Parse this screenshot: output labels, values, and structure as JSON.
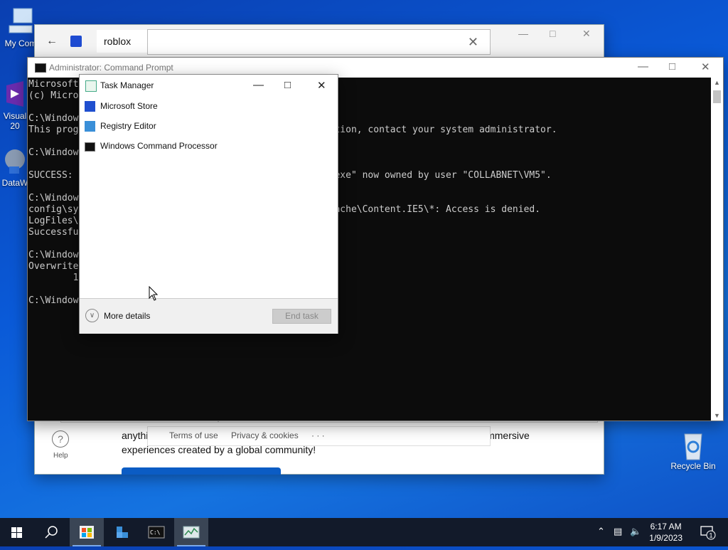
{
  "desktop": {
    "icons": [
      {
        "label": "My Com",
        "icon": "computer-icon"
      },
      {
        "label": "Visual",
        "sublabel": "20",
        "icon": "visual-studio-icon"
      },
      {
        "label": "DataW",
        "icon": "datawarehouse-icon"
      },
      {
        "label": "Recycle Bin",
        "icon": "recycle-bin-icon"
      }
    ]
  },
  "store": {
    "tab_label": "roblox",
    "search_value": "",
    "help_label": "Help",
    "description": "anythi                                                                                               immersive experiences created by a global community!",
    "description_line1_left": "anythi",
    "description_line1_right": "immersive",
    "description_line2": "experiences created by a global community!",
    "footer": {
      "terms": "Terms of use",
      "privacy": "Privacy & cookies",
      "more": "· · ·"
    }
  },
  "cmd": {
    "title": "Administrator: Command Prompt",
    "lines": [
      "Microsoft",
      "(c) Micro",
      "",
      "C:\\Window",
      "This prog                                          ormation, contact your system administrator.",
      "",
      "C:\\Window",
      "",
      "SUCCESS:                                           chc.exe\" now owned by user \"COLLABNET\\VM5\".",
      "",
      "C:\\Window",
      "config\\sy                                          NetCache\\Content.IE5\\*: Access is denied.",
      "LogFiles\\",
      "Successfu                                           .es",
      "",
      "C:\\Window",
      "Overwrite",
      "        1",
      "",
      "C:\\Window"
    ]
  },
  "taskmanager": {
    "title": "Task Manager",
    "apps": [
      {
        "label": "Microsoft Store",
        "icon": "store-icon"
      },
      {
        "label": "Registry Editor",
        "icon": "registry-editor-icon"
      },
      {
        "label": "Windows Command Processor",
        "icon": "cmd-icon"
      }
    ],
    "more_details": "More details",
    "end_task": "End task"
  },
  "taskbar": {
    "time": "6:17 AM",
    "date": "1/9/2023",
    "notification_count": "1"
  },
  "colors": {
    "accent": "#0b5cc4",
    "taskbar": "#121a2a",
    "cmd_bg": "#0c0c0c"
  }
}
